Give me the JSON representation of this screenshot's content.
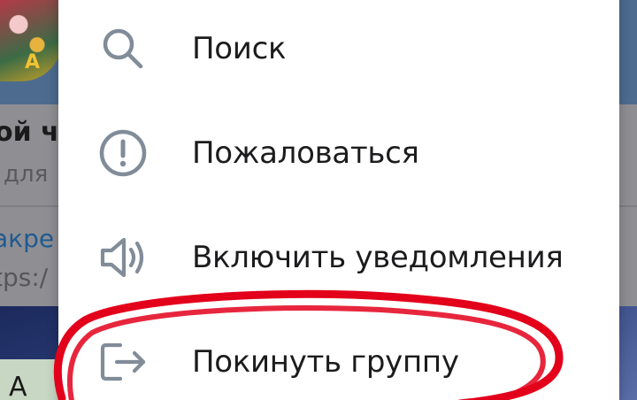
{
  "background": {
    "title_fragment": "ой ч",
    "subtitle_fragment": "для",
    "pinned_label_fragment": "акре",
    "pinned_link_fragment": "tps:/",
    "image_text_fragment": "А",
    "avatar_letter": "A"
  },
  "menu": {
    "items": [
      {
        "label": "Поиск",
        "icon": "search-icon"
      },
      {
        "label": "Пожаловаться",
        "icon": "report-icon"
      },
      {
        "label": "Включить уведомления",
        "icon": "speaker-icon"
      },
      {
        "label": "Покинуть группу",
        "icon": "leave-icon"
      }
    ]
  },
  "colors": {
    "icon_color": "#818c99",
    "annotation_color": "#e3001b",
    "menu_text": "#1c1c1e",
    "link_blue": "#1f5a91"
  }
}
